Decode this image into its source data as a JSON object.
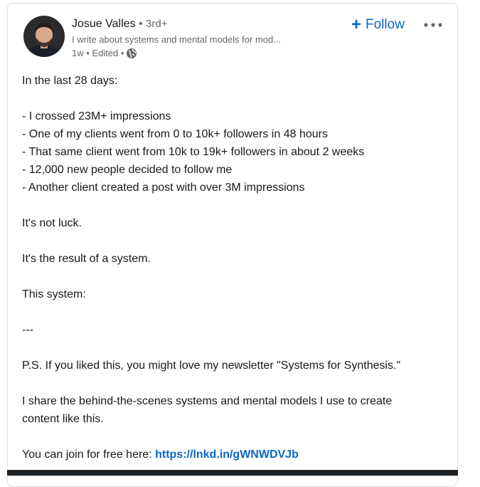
{
  "author": {
    "name": "Josue Valles",
    "separator": "•",
    "degree": "3rd+",
    "headline": "I write about systems and mental models for mod...",
    "time": "1w",
    "edited": "Edited",
    "dot": "•"
  },
  "actions": {
    "follow_plus": "+",
    "follow_label": "Follow"
  },
  "post": {
    "lines": [
      "In the last 28 days:",
      "",
      "- I crossed 23M+ impressions",
      "- One of my clients went from 0 to 10k+ followers in 48 hours",
      "- That same client went from 10k to 19k+ followers in about 2 weeks",
      "- 12,000 new people decided to follow me",
      "- Another client created a post with over 3M impressions",
      "",
      "It's not luck.",
      "",
      "It's the result of a system.",
      "",
      "This system:",
      "",
      "---",
      "",
      "P.S. If you liked this, you might love my newsletter \"Systems for Synthesis.\"",
      "",
      "I share the behind-the-scenes systems and mental models I use to create",
      "content like this.",
      ""
    ],
    "join_text": "You can join for free here: ",
    "join_link": "https://lnkd.in/gWNWDVJb"
  },
  "icons": {
    "avatar": "avatar",
    "globe": "globe-icon",
    "more": "more-icon"
  },
  "colors": {
    "link": "#0a66c2",
    "text": "#191919",
    "muted": "#666666"
  }
}
